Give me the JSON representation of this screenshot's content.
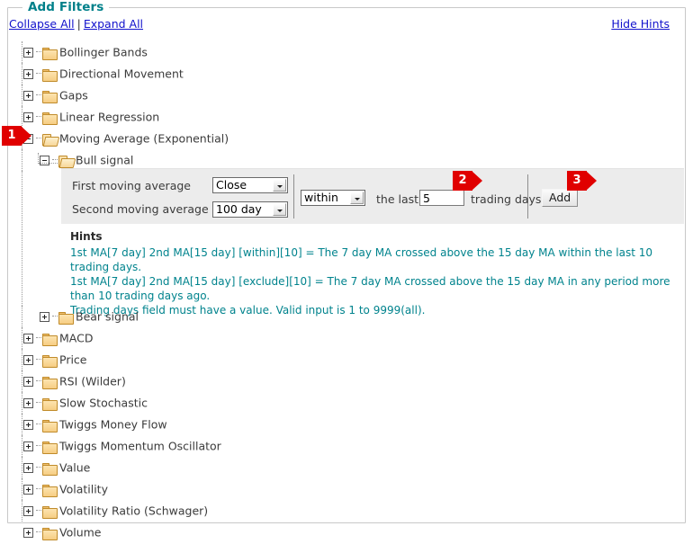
{
  "frame": {
    "legend": "Add Filters"
  },
  "linkbar": {
    "collapse_all": "Collapse All",
    "separator": "|",
    "expand_all": "Expand All",
    "hide_hints": "Hide Hints"
  },
  "colors": {
    "legend_teal": "#00808a",
    "hint_teal": "#00838d",
    "link_blue": "#1111cc",
    "callout_red": "#e00000",
    "panel_gray": "#ececec",
    "folder_fill": "#f6cd83"
  },
  "tree": [
    {
      "label": "Bollinger Bands",
      "level": 1,
      "state": "collapsed",
      "icon": "folder-closed-icon"
    },
    {
      "label": "Directional Movement",
      "level": 1,
      "state": "collapsed",
      "icon": "folder-closed-icon"
    },
    {
      "label": "Gaps",
      "level": 1,
      "state": "collapsed",
      "icon": "folder-closed-icon"
    },
    {
      "label": "Linear Regression",
      "level": 1,
      "state": "collapsed",
      "icon": "folder-closed-icon"
    },
    {
      "label": "Moving Average (Exponential)",
      "level": 1,
      "state": "expanded",
      "icon": "folder-open-icon"
    },
    {
      "label": "Bull signal",
      "level": 2,
      "state": "expanded",
      "icon": "folder-open-icon"
    }
  ],
  "tree_after": [
    {
      "label": "Bear signal",
      "level": 2,
      "state": "collapsed",
      "icon": "folder-closed-icon"
    },
    {
      "label": "MACD",
      "level": 1,
      "state": "collapsed",
      "icon": "folder-closed-icon"
    },
    {
      "label": "Price",
      "level": 1,
      "state": "collapsed",
      "icon": "folder-closed-icon"
    },
    {
      "label": "RSI (Wilder)",
      "level": 1,
      "state": "collapsed",
      "icon": "folder-closed-icon"
    },
    {
      "label": "Slow Stochastic",
      "level": 1,
      "state": "collapsed",
      "icon": "folder-closed-icon"
    },
    {
      "label": "Twiggs Money Flow",
      "level": 1,
      "state": "collapsed",
      "icon": "folder-closed-icon"
    },
    {
      "label": "Twiggs Momentum Oscillator",
      "level": 1,
      "state": "collapsed",
      "icon": "folder-closed-icon"
    },
    {
      "label": "Value",
      "level": 1,
      "state": "collapsed",
      "icon": "folder-closed-icon"
    },
    {
      "label": "Volatility",
      "level": 1,
      "state": "collapsed",
      "icon": "folder-closed-icon"
    },
    {
      "label": "Volatility Ratio (Schwager)",
      "level": 1,
      "state": "collapsed",
      "icon": "folder-closed-icon"
    },
    {
      "label": "Volume",
      "level": 1,
      "state": "collapsed",
      "icon": "folder-closed-icon"
    }
  ],
  "panel": {
    "first_ma_label": "First moving average",
    "first_ma_value": "Close",
    "second_ma_label": "Second moving average",
    "second_ma_value": "100 day",
    "condition_value": "within",
    "the_last_label": "the last",
    "trading_days_value": "5",
    "trading_days_label": "trading days",
    "add_label": "Add"
  },
  "hints": {
    "title": "Hints",
    "lines": [
      "1st MA[7 day] 2nd MA[15 day] [within][10] = The 7 day MA crossed above the 15 day MA within the last 10 trading days.",
      "1st MA[7 day] 2nd MA[15 day] [exclude][10] = The 7 day MA crossed above the 15 day MA in any period more than 10 trading days ago.",
      "Trading days field must have a value. Valid input is 1 to 9999(all)."
    ]
  },
  "callouts": [
    {
      "number": "1"
    },
    {
      "number": "2"
    },
    {
      "number": "3"
    }
  ]
}
